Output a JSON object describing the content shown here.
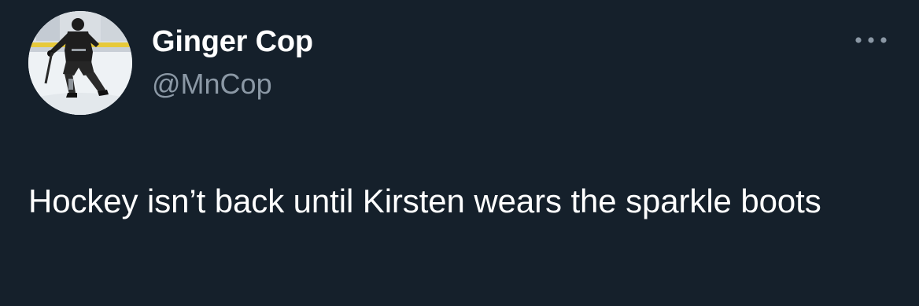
{
  "tweet": {
    "author": {
      "display_name": "Ginger Cop",
      "handle": "@MnCop",
      "avatar": "hockey-player-photo"
    },
    "more_icon": "more-horizontal-icon",
    "text": "Hockey isn’t back until Kirsten wears the sparkle boots"
  },
  "colors": {
    "background": "#15202b",
    "primary_text": "#ffffff",
    "secondary_text": "#8b98a5"
  }
}
